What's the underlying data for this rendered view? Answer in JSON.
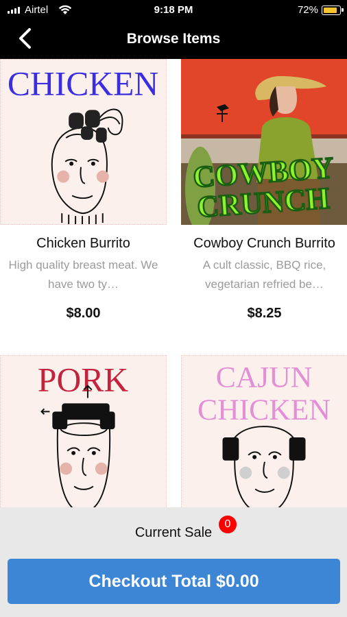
{
  "status_bar": {
    "carrier": "Airtel",
    "time": "9:18 PM",
    "battery_pct": "72%",
    "battery_color": "#f6c431"
  },
  "nav": {
    "title": "Browse Items",
    "back_icon": "chevron-left-icon"
  },
  "items": [
    {
      "art_text": [
        "CHICKEN"
      ],
      "art_color": "#3a2ee0",
      "name": "Chicken Burrito",
      "description": "High quality breast meat. We have two ty…",
      "price": "$8.00"
    },
    {
      "art_text": [
        "COWBOY",
        "CRUNCH"
      ],
      "art_color": "#8ef22c",
      "name": "Cowboy Crunch Burrito",
      "description": "A cult classic, BBQ rice, vegetarian refried be…",
      "price": "$8.25"
    },
    {
      "art_text": [
        "PORK"
      ],
      "art_color": "#c4233d",
      "name": "",
      "description": "",
      "price": ""
    },
    {
      "art_text": [
        "CAJUN",
        "CHICKEN"
      ],
      "art_color": "#e28fd6",
      "name": "",
      "description": "",
      "price": ""
    }
  ],
  "cart": {
    "label": "Current Sale",
    "count": "0",
    "badge_color": "#ff0000",
    "checkout_label": "Checkout Total $0.00",
    "checkout_color": "#3d86d6"
  }
}
